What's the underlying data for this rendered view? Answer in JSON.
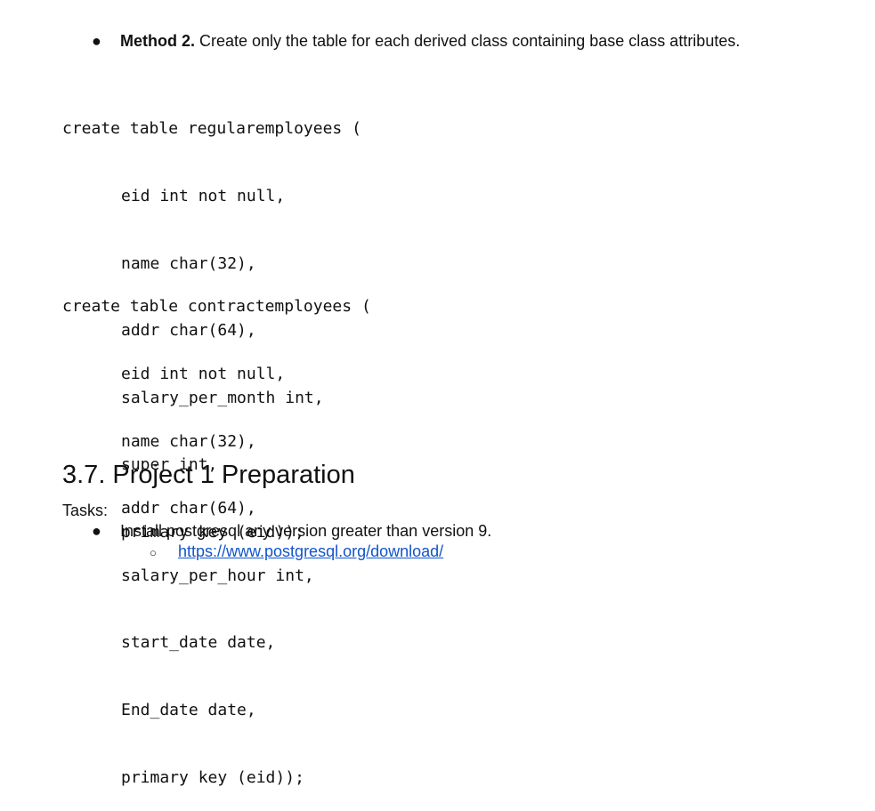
{
  "method2": {
    "bold": "Method 2.",
    "text": " Create only the table for each derived class containing base class attributes."
  },
  "code_block_1": [
    "create table regularemployees (",
    "eid int not null,",
    "name char(32),",
    "addr char(64),",
    "salary_per_month int,",
    "super int,",
    "primary key (eid));"
  ],
  "code_block_2": [
    "create table contractemployees (",
    "eid int not null,",
    "name char(32),",
    "addr char(64),",
    "salary_per_hour int,",
    "start_date date,",
    "End_date date,",
    "primary key (eid));"
  ],
  "section": {
    "heading": "3.7. Project 1 Preparation",
    "tasks_label": "Tasks:",
    "task_1": "Install postgresql any version greater than version 9.",
    "link": "https://www.postgresql.org/download/"
  },
  "glyphs": {
    "bullet": "●",
    "sub_bullet": "○"
  },
  "colors": {
    "link": "#1155cc",
    "text": "#111111"
  }
}
